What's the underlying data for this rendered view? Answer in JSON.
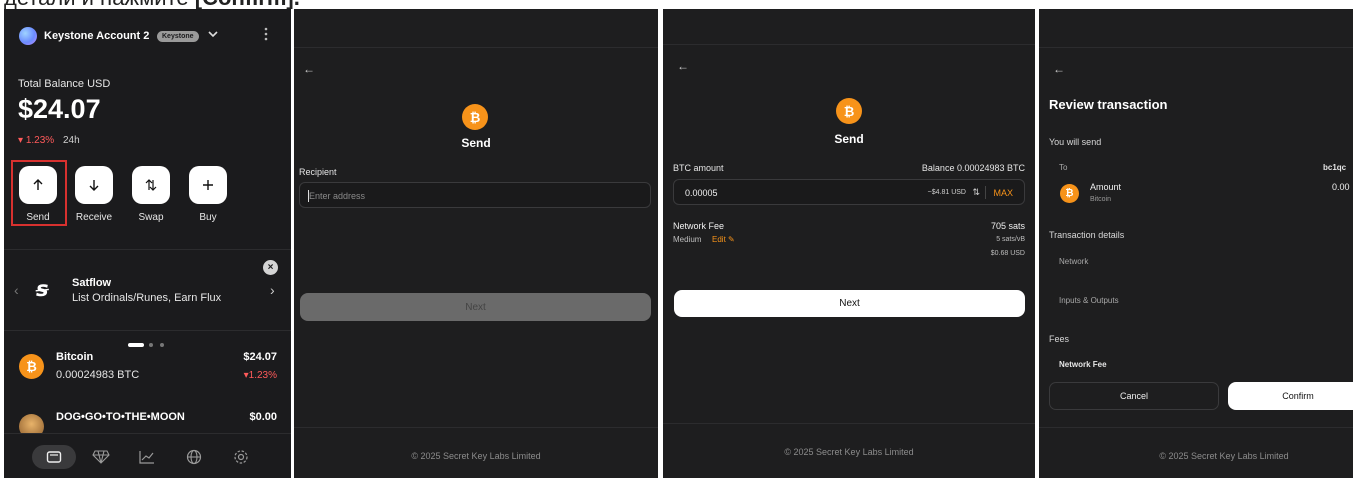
{
  "caption": {
    "prefix": "детали и нажмите ",
    "bold": "[Confirm]."
  },
  "wallet": {
    "account_name": "Keystone Account 2",
    "badge": "Keystone",
    "balance_label": "Total Balance USD",
    "balance": "$24.07",
    "change": "1.23%",
    "period": "24h",
    "actions": [
      {
        "label": "Send",
        "icon": "arrow-up-icon"
      },
      {
        "label": "Receive",
        "icon": "arrow-down-icon"
      },
      {
        "label": "Swap",
        "icon": "swap-icon"
      },
      {
        "label": "Buy",
        "icon": "plus-icon"
      }
    ],
    "promo": {
      "title": "Satflow",
      "subtitle": "List Ordinals/Runes, Earn Flux"
    },
    "assets": [
      {
        "name": "Bitcoin",
        "amount": "0.00024983 BTC",
        "value": "$24.07",
        "change": "1.23%"
      },
      {
        "name": "DOG•GO•TO•THE•MOON",
        "amount": "",
        "value": "$0.00"
      }
    ],
    "nav": [
      "wallet-icon",
      "diamond-icon",
      "chart-icon",
      "globe-icon",
      "gear-icon"
    ]
  },
  "send_recipient": {
    "title": "Send",
    "recipient_label": "Recipient",
    "placeholder": "Enter address",
    "next": "Next",
    "footer": "© 2025 Secret Key Labs Limited"
  },
  "send_amount": {
    "title": "Send",
    "amount_label": "BTC amount",
    "balance_text": "Balance 0.00024983 BTC",
    "amount_value": "0.00005",
    "usd_value": "~$4.81 USD",
    "max": "MAX",
    "fee_label": "Network Fee",
    "fee_speed": "Medium",
    "edit": "Edit",
    "fee_sats": "705 sats",
    "fee_rate": "5 sats/vB",
    "fee_usd": "$0.68 USD",
    "next": "Next",
    "footer": "© 2025 Secret Key Labs Limited"
  },
  "review": {
    "title": "Review transaction",
    "you_will_send": "You will send",
    "to_label": "To",
    "to_value": "bc1qc",
    "amount_label": "Amount",
    "amount_sub": "Bitcoin",
    "amount_value": "0.00",
    "details_label": "Transaction details",
    "network": "Network",
    "inputs_outputs": "Inputs & Outputs",
    "fees": "Fees",
    "network_fee": "Network Fee",
    "cancel": "Cancel",
    "confirm": "Confirm",
    "footer": "© 2025 Secret Key Labs Limited"
  },
  "colors": {
    "accent_red": "#d8312f",
    "orange": "#f7931a",
    "negative": "#ff5a5a"
  }
}
